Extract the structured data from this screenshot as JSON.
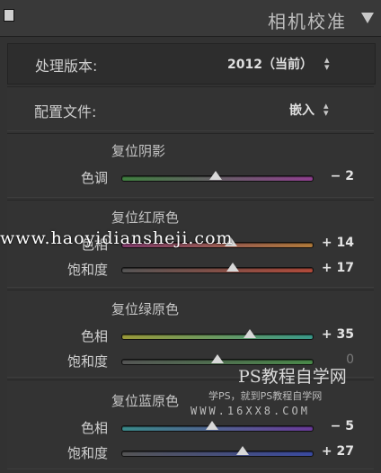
{
  "header": {
    "title": "相机校准",
    "collapse_icon": "triangle-down-icon"
  },
  "process": {
    "label": "处理版本:",
    "value": "2012（当前）"
  },
  "profile": {
    "label": "配置文件:",
    "value": "嵌入"
  },
  "groups": {
    "shadows": {
      "title": "复位阴影",
      "sliders": [
        {
          "label": "色调",
          "value": "− 2",
          "position": 0.49,
          "dim": false,
          "gradient": [
            "#3f7f3f",
            "#8f3f8f"
          ]
        }
      ]
    },
    "red": {
      "title": "复位红原色",
      "sliders": [
        {
          "label": "色相",
          "value": "+ 14",
          "position": 0.57,
          "dim": false,
          "gradient": [
            "#7f3a6a",
            "#b07a3a"
          ]
        },
        {
          "label": "饱和度",
          "value": "+ 17",
          "position": 0.58,
          "dim": false,
          "gradient": [
            "#555555",
            "#b04a3a"
          ]
        }
      ]
    },
    "green": {
      "title": "复位绿原色",
      "sliders": [
        {
          "label": "色相",
          "value": "+ 35",
          "position": 0.67,
          "dim": false,
          "gradient": [
            "#9a9a3a",
            "#3a9a8a"
          ]
        },
        {
          "label": "饱和度",
          "value": "0",
          "position": 0.5,
          "dim": true,
          "gradient": [
            "#555555",
            "#4a8a4a"
          ]
        }
      ]
    },
    "blue": {
      "title": "复位蓝原色",
      "sliders": [
        {
          "label": "色相",
          "value": "− 5",
          "position": 0.47,
          "dim": false,
          "gradient": [
            "#3a8a8a",
            "#6a3a9a"
          ]
        },
        {
          "label": "饱和度",
          "value": "+ 27",
          "position": 0.63,
          "dim": false,
          "gradient": [
            "#555555",
            "#3a4aa0"
          ]
        }
      ]
    }
  },
  "watermarks": {
    "url": "www.haoyidiansheji.com",
    "logo": "PS教程自学网",
    "sub": "学PS，就到PS教程自学网",
    "site": "WWW.16XX8.COM"
  }
}
